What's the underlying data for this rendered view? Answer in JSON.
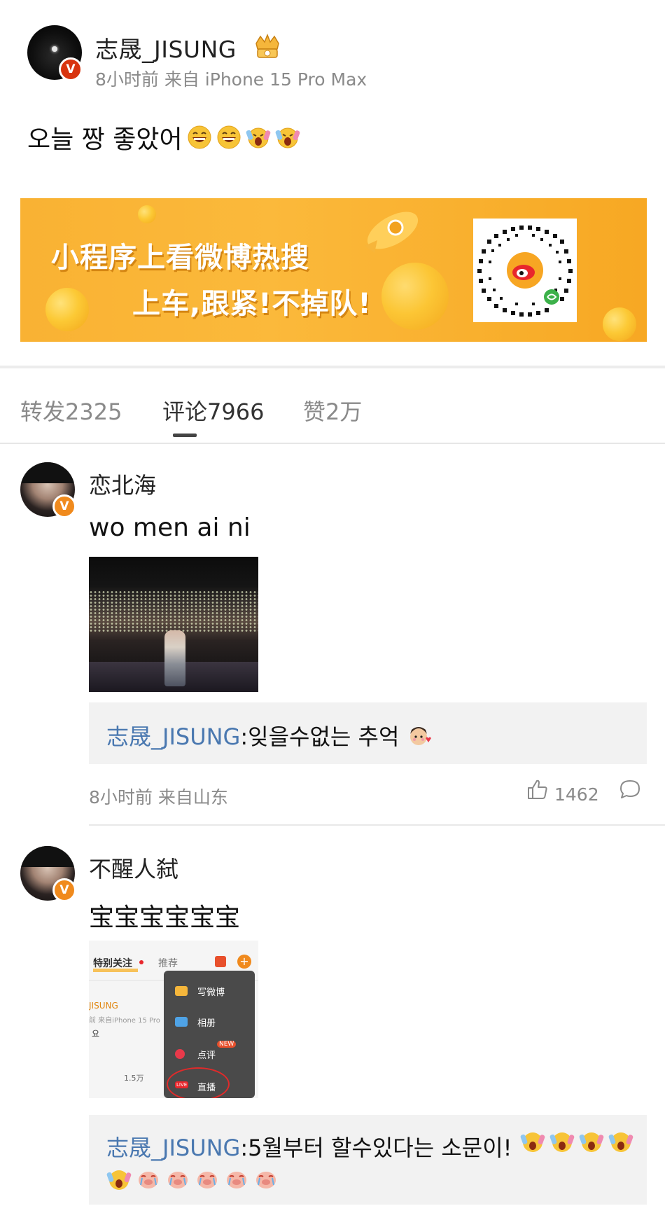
{
  "post": {
    "author": "志晟_JISUNG",
    "meta": "8小时前 来自 iPhone 15 Pro Max",
    "text": "오늘 짱 좋았어",
    "emojis": [
      "laugh-emoji",
      "laugh-emoji",
      "scream-emoji",
      "scream-emoji"
    ]
  },
  "banner": {
    "line1": "小程序上看微博热搜",
    "line2": "上车,跟紧!不掉队!"
  },
  "tabs": {
    "repost": "转发2325",
    "comments": "评论7966",
    "likes": "赞2万"
  },
  "comments": [
    {
      "name": "恋北海",
      "text": "wo men ai ni",
      "reply_author": "志晟_JISUNG",
      "reply_text": ":잊을수없는 추억",
      "meta": "8小时前 来自山东",
      "likes": "1462"
    },
    {
      "name": "不醒人弑",
      "text": "宝宝宝宝宝宝",
      "reply_author": "志晟_JISUNG",
      "reply_text": ":5월부터 할수있다는 소문이!"
    }
  ],
  "screenshot": {
    "tab1": "特别关注",
    "tab2": "推荐",
    "user": "JISUNG",
    "meta": "前  来自iPhone 15 Pro",
    "text": "요",
    "count": "1.5万",
    "menu": [
      "写微博",
      "相册",
      "点评",
      "直播"
    ],
    "new_badge": "NEW",
    "live_badge": "LIVE"
  },
  "colors": {
    "link": "#4a78b0",
    "badge_orange": "#f08a1d",
    "badge_red": "#d8340f",
    "banner_yellow": "#f9b233"
  }
}
